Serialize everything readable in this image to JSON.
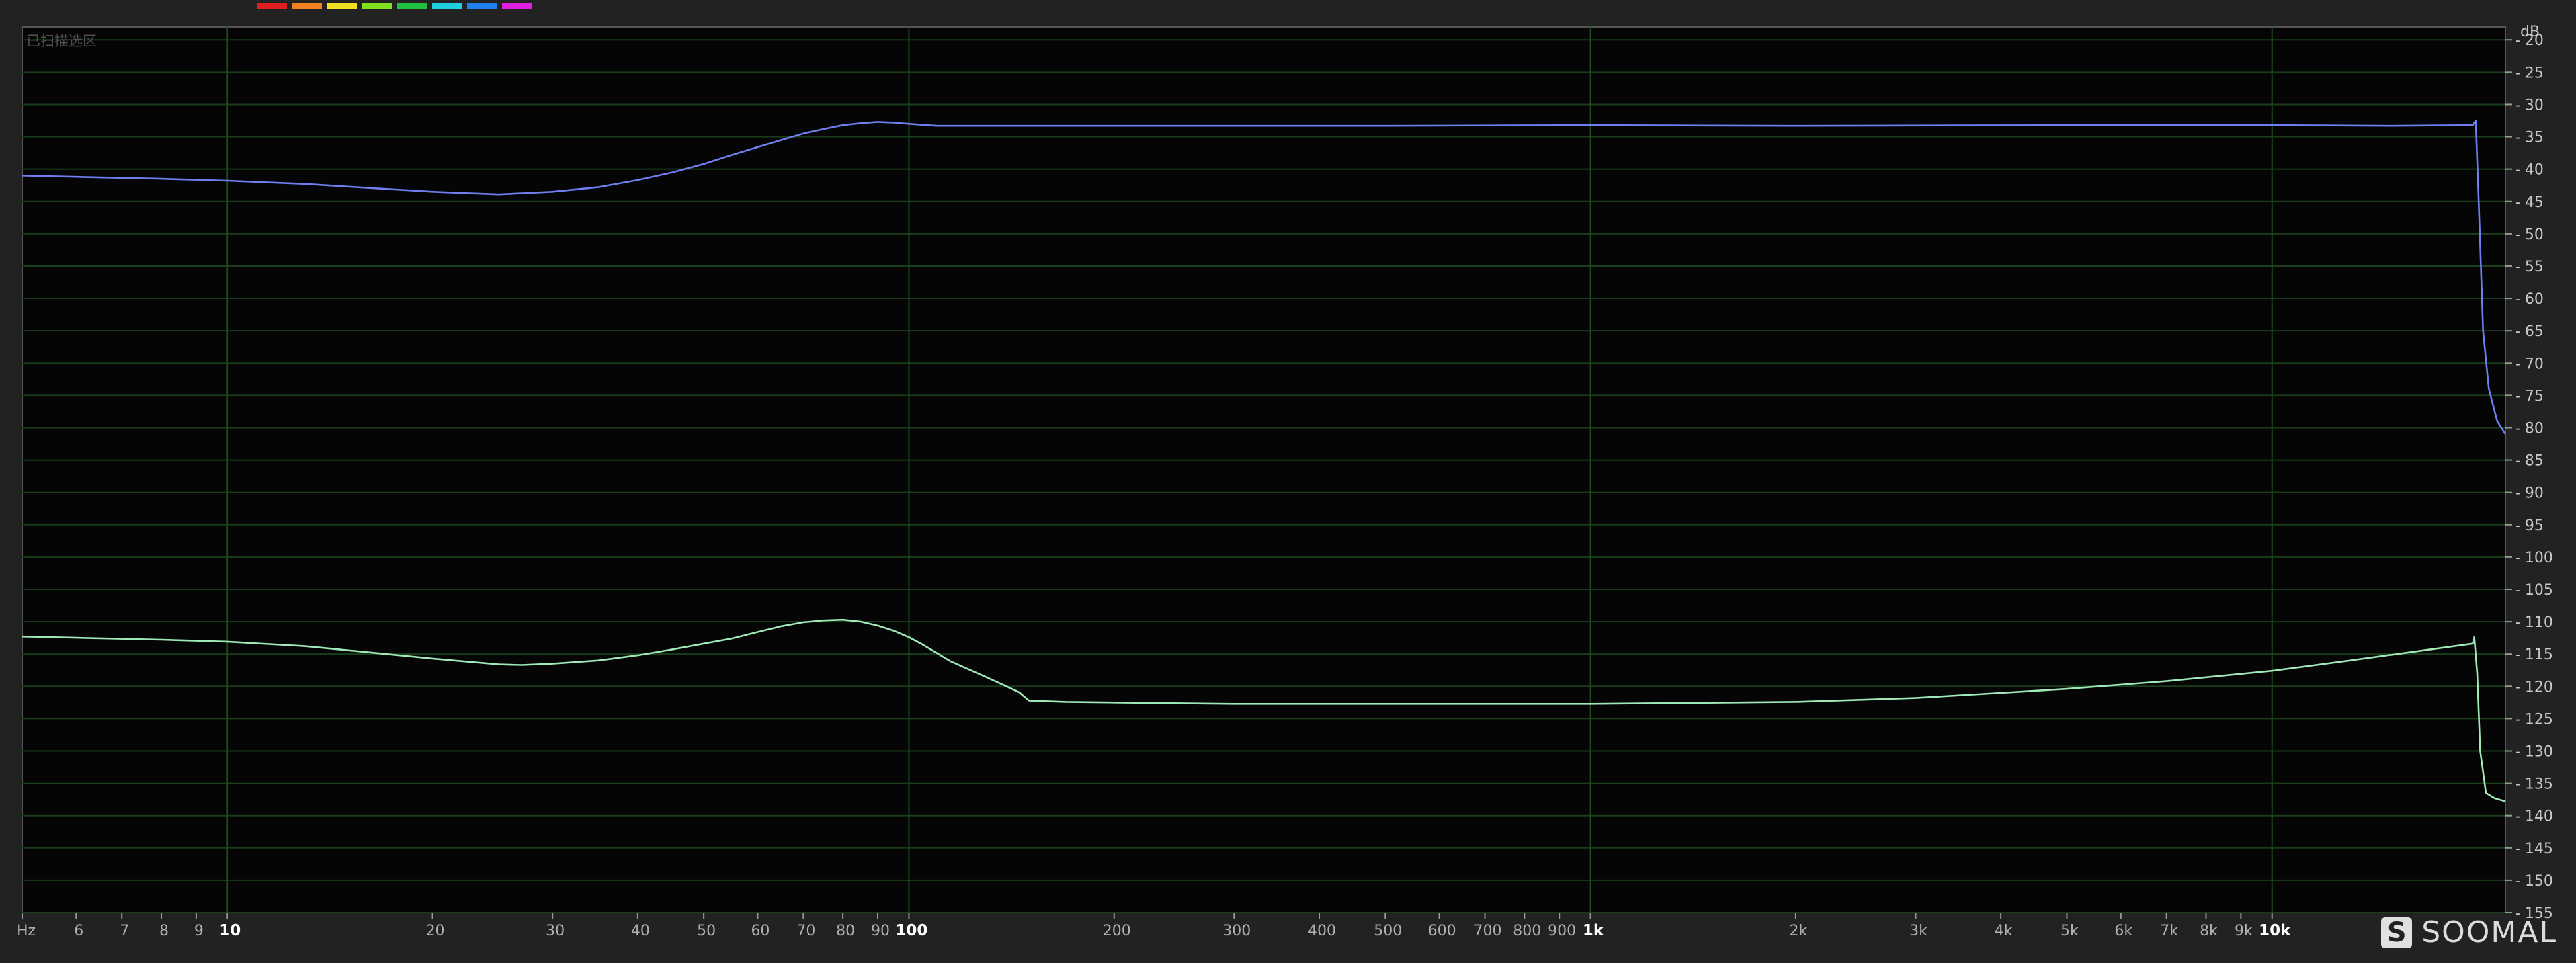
{
  "chart_data": {
    "type": "line",
    "corner_label": "已扫描选区",
    "xlabel": "Hz",
    "ylabel": "dB",
    "xscale": "log",
    "xlim": [
      5,
      22000
    ],
    "ylim": [
      -155,
      -18
    ],
    "grid": true,
    "legend_swatches": [
      "#e02020",
      "#f08020",
      "#f0e020",
      "#80e020",
      "#20c040",
      "#20d0e0",
      "#2080f0",
      "#e020e0"
    ],
    "x_ticks": [
      {
        "value": 5,
        "label": "Hz"
      },
      {
        "value": 6,
        "label": "6"
      },
      {
        "value": 7,
        "label": "7"
      },
      {
        "value": 8,
        "label": "8"
      },
      {
        "value": 9,
        "label": "9"
      },
      {
        "value": 10,
        "label": "10",
        "major": true
      },
      {
        "value": 20,
        "label": "20"
      },
      {
        "value": 30,
        "label": "30"
      },
      {
        "value": 40,
        "label": "40"
      },
      {
        "value": 50,
        "label": "50"
      },
      {
        "value": 60,
        "label": "60"
      },
      {
        "value": 70,
        "label": "70"
      },
      {
        "value": 80,
        "label": "80"
      },
      {
        "value": 90,
        "label": "90"
      },
      {
        "value": 100,
        "label": "100",
        "major": true
      },
      {
        "value": 200,
        "label": "200"
      },
      {
        "value": 300,
        "label": "300"
      },
      {
        "value": 400,
        "label": "400"
      },
      {
        "value": 500,
        "label": "500"
      },
      {
        "value": 600,
        "label": "600"
      },
      {
        "value": 700,
        "label": "700"
      },
      {
        "value": 800,
        "label": "800"
      },
      {
        "value": 900,
        "label": "900"
      },
      {
        "value": 1000,
        "label": "1k",
        "major": true
      },
      {
        "value": 2000,
        "label": "2k"
      },
      {
        "value": 3000,
        "label": "3k"
      },
      {
        "value": 4000,
        "label": "4k"
      },
      {
        "value": 5000,
        "label": "5k"
      },
      {
        "value": 6000,
        "label": "6k"
      },
      {
        "value": 7000,
        "label": "7k"
      },
      {
        "value": 8000,
        "label": "8k"
      },
      {
        "value": 9000,
        "label": "9k"
      },
      {
        "value": 10000,
        "label": "10k",
        "major": true
      }
    ],
    "y_ticks": [
      -20,
      -25,
      -30,
      -35,
      -40,
      -45,
      -50,
      -55,
      -60,
      -65,
      -70,
      -75,
      -80,
      -85,
      -90,
      -95,
      -100,
      -105,
      -110,
      -115,
      -120,
      -125,
      -130,
      -135,
      -140,
      -145,
      -150,
      -155
    ],
    "series": [
      {
        "color": "#6f7ff0",
        "x": [
          5,
          6,
          8,
          10,
          13,
          16,
          20,
          25,
          30,
          35,
          40,
          45,
          50,
          55,
          60,
          65,
          70,
          75,
          80,
          85,
          90,
          95,
          100,
          110,
          130,
          160,
          200,
          300,
          500,
          1000,
          2000,
          5000,
          10000,
          15000,
          19700,
          19900,
          20100,
          20400,
          20800,
          21400,
          22000
        ],
        "y": [
          -41,
          -41.2,
          -41.5,
          -41.8,
          -42.3,
          -42.9,
          -43.5,
          -43.9,
          -43.5,
          -42.8,
          -41.7,
          -40.5,
          -39.2,
          -37.8,
          -36.6,
          -35.5,
          -34.5,
          -33.8,
          -33.2,
          -32.9,
          -32.7,
          -32.8,
          -33.0,
          -33.3,
          -33.3,
          -33.3,
          -33.3,
          -33.3,
          -33.3,
          -33.2,
          -33.3,
          -33.2,
          -33.2,
          -33.3,
          -33.2,
          -32.5,
          -45,
          -65,
          -74,
          -79,
          -81
        ]
      },
      {
        "color": "#9fe8b8",
        "x": [
          5,
          6,
          8,
          10,
          13,
          16,
          20,
          25,
          27,
          30,
          35,
          40,
          45,
          50,
          55,
          60,
          65,
          70,
          75,
          80,
          85,
          90,
          95,
          100,
          105,
          115,
          130,
          145,
          150,
          170,
          200,
          300,
          500,
          1000,
          2000,
          3000,
          5000,
          7000,
          10000,
          13000,
          16000,
          19700,
          19800,
          20000,
          20200,
          20600,
          21200,
          22000
        ],
        "y": [
          -112.3,
          -112.5,
          -112.8,
          -113.1,
          -113.8,
          -114.7,
          -115.7,
          -116.6,
          -116.7,
          -116.5,
          -116,
          -115.2,
          -114.3,
          -113.4,
          -112.6,
          -111.6,
          -110.7,
          -110.1,
          -109.8,
          -109.7,
          -110.0,
          -110.6,
          -111.4,
          -112.4,
          -113.6,
          -116.1,
          -118.6,
          -120.9,
          -122.2,
          -122.4,
          -122.5,
          -122.7,
          -122.7,
          -122.7,
          -122.4,
          -121.8,
          -120.4,
          -119.2,
          -117.6,
          -116.0,
          -114.7,
          -113.4,
          -112.4,
          -118,
          -130,
          -136.5,
          -137.3,
          -137.8
        ]
      }
    ]
  },
  "watermark": {
    "logo_glyph": "S",
    "text": "SOOMAL"
  }
}
